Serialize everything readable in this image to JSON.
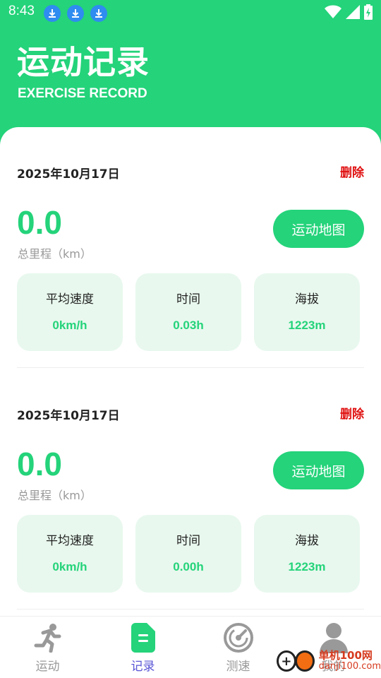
{
  "status_bar": {
    "time": "8:43",
    "icons": [
      "download-icon",
      "download-icon",
      "download-icon",
      "wifi-icon",
      "signal-icon",
      "battery-charging-icon"
    ]
  },
  "header": {
    "title": "运动记录",
    "subtitle": "EXERCISE RECORD"
  },
  "records": [
    {
      "date": "2025年10月17日",
      "delete_label": "删除",
      "distance": "0.0",
      "distance_label": "总里程（km）",
      "map_button": "运动地图",
      "stats": [
        {
          "label": "平均速度",
          "value": "0km/h"
        },
        {
          "label": "时间",
          "value": "0.03h"
        },
        {
          "label": "海拔",
          "value": "1223m"
        }
      ]
    },
    {
      "date": "2025年10月17日",
      "delete_label": "删除",
      "distance": "0.0",
      "distance_label": "总里程（km）",
      "map_button": "运动地图",
      "stats": [
        {
          "label": "平均速度",
          "value": "0km/h"
        },
        {
          "label": "时间",
          "value": "0.00h"
        },
        {
          "label": "海拔",
          "value": "1223m"
        }
      ]
    }
  ],
  "bottom_nav": {
    "items": [
      {
        "label": "运动",
        "icon": "running-icon",
        "active": false
      },
      {
        "label": "记录",
        "icon": "document-icon",
        "active": true
      },
      {
        "label": "测速",
        "icon": "speedometer-icon",
        "active": false
      },
      {
        "label": "我的",
        "icon": "user-icon",
        "active": false
      }
    ]
  },
  "watermark": {
    "name": "单机100网",
    "url": "danji100.com"
  },
  "colors": {
    "primary": "#24D37A",
    "stat_bg": "#E8F8EE",
    "delete": "#E01010",
    "nav_active": "#5A55D6"
  }
}
